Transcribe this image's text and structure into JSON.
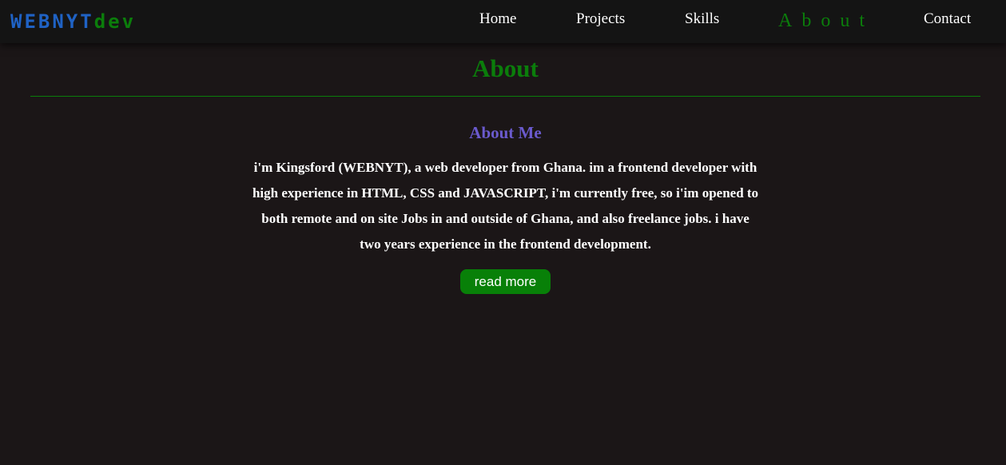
{
  "logo": {
    "part1": "WEBNYT",
    "part2": "dev"
  },
  "nav": {
    "items": [
      {
        "label": "Home"
      },
      {
        "label": "Projects"
      },
      {
        "label": "Skills"
      },
      {
        "label": "About",
        "active": true
      },
      {
        "label": "Contact"
      }
    ]
  },
  "main": {
    "title": "About",
    "subheading": "About Me",
    "paragraph": "i'm Kingsford (WEBNYT), a web developer from Ghana. im a frontend developer with high experience in HTML, CSS and JAVASCRIPT, i'm currently free, so i'im opened to both remote and on site Jobs in and outside of Ghana, and also freelance jobs. i have two years experience in the frontend development.",
    "button_label": "read more"
  },
  "colors": {
    "background": "#1b1617",
    "navbar": "#141414",
    "accent_green": "#0b7d0b",
    "logo_blue": "#1f62c4",
    "subheading_purple": "#6a5acd",
    "button_green": "#088008"
  }
}
